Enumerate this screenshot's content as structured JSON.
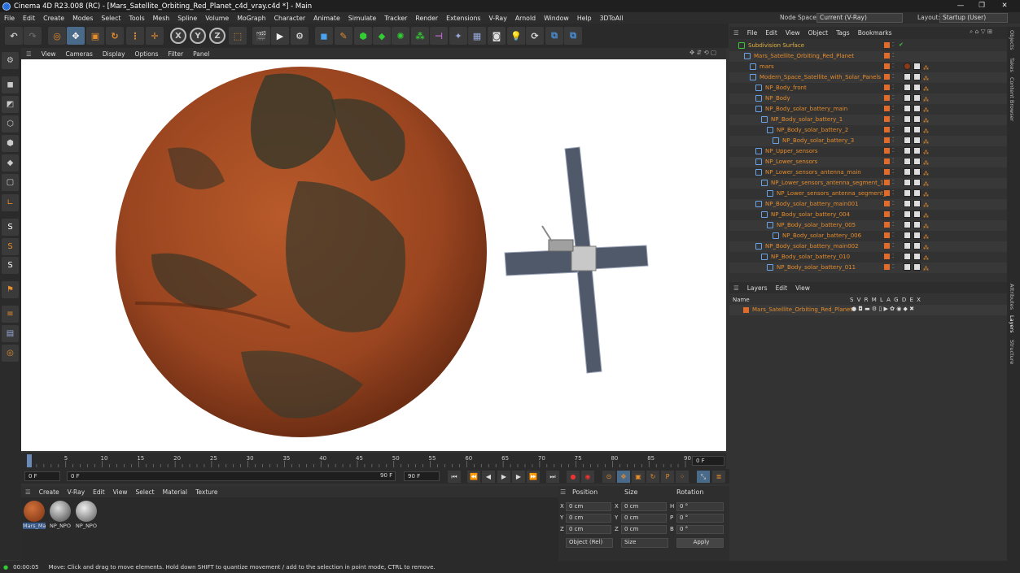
{
  "title": "Cinema 4D R23.008 (RC) - [Mars_Satellite_Orbiting_Red_Planet_c4d_vray.c4d *] - Main",
  "window_controls": [
    "—",
    "❐",
    "✕"
  ],
  "menu": [
    "File",
    "Edit",
    "Create",
    "Modes",
    "Select",
    "Tools",
    "Mesh",
    "Spline",
    "Volume",
    "MoGraph",
    "Character",
    "Animate",
    "Simulate",
    "Tracker",
    "Render",
    "Extensions",
    "V-Ray",
    "Arnold",
    "Window",
    "Help",
    "3DToAll"
  ],
  "node_space": {
    "label": "Node Space:",
    "value": "Current (V-Ray)"
  },
  "layout": {
    "label": "Layout:",
    "value": "Startup (User)"
  },
  "viewport_menu": [
    "View",
    "Cameras",
    "Display",
    "Options",
    "Filter",
    "Panel"
  ],
  "timeline": {
    "ticks": [
      "0",
      "5",
      "10",
      "15",
      "20",
      "25",
      "30",
      "35",
      "40",
      "45",
      "50",
      "55",
      "60",
      "65",
      "70",
      "75",
      "80",
      "85",
      "90"
    ],
    "current_frame_right": "0 F"
  },
  "transport": {
    "start": "0 F",
    "current": "0 F",
    "end_slider": "90 F",
    "end": "90 F"
  },
  "material_menu": [
    "Create",
    "V-Ray",
    "Edit",
    "View",
    "Select",
    "Material",
    "Texture"
  ],
  "materials": [
    {
      "label": "Mars_Ma",
      "color": "#a8451c"
    },
    {
      "label": "NP_NPO",
      "color": "#777777"
    },
    {
      "label": "NP_NPO",
      "color": "#888888"
    }
  ],
  "coords": {
    "headers": [
      "Position",
      "Size",
      "Rotation"
    ],
    "rows": [
      {
        "axis": "X",
        "pos": "0 cm",
        "saxis": "X",
        "size": "0 cm",
        "raxis": "H",
        "rot": "0 °"
      },
      {
        "axis": "Y",
        "pos": "0 cm",
        "saxis": "Y",
        "size": "0 cm",
        "raxis": "P",
        "rot": "0 °"
      },
      {
        "axis": "Z",
        "pos": "0 cm",
        "saxis": "Z",
        "size": "0 cm",
        "raxis": "B",
        "rot": "0 °"
      }
    ],
    "mode": "Object (Rel)",
    "size_mode": "Size",
    "apply": "Apply"
  },
  "status": {
    "time": "00:00:05",
    "message": "Move: Click and drag to move elements. Hold down SHIFT to quantize movement / add to the selection in point mode, CTRL to remove."
  },
  "object_menu": [
    "File",
    "Edit",
    "View",
    "Object",
    "Tags",
    "Bookmarks"
  ],
  "objects": [
    {
      "name": "Subdivision Surface",
      "indent": 0,
      "color": "#e0b040"
    },
    {
      "name": "Mars_Satellite_Orbiting_Red_Planet",
      "indent": 1
    },
    {
      "name": "mars",
      "indent": 2
    },
    {
      "name": "Modern_Space_Satellite_with_Solar_Panels",
      "indent": 2
    },
    {
      "name": "NP_Body_front",
      "indent": 3
    },
    {
      "name": "NP_Body",
      "indent": 3
    },
    {
      "name": "NP_Body_solar_battery_main",
      "indent": 3
    },
    {
      "name": "NP_Body_solar_battery_1",
      "indent": 4
    },
    {
      "name": "NP_Body_solar_battery_2",
      "indent": 5
    },
    {
      "name": "NP_Body_solar_battery_3",
      "indent": 6
    },
    {
      "name": "NP_Upper_sensors",
      "indent": 3
    },
    {
      "name": "NP_Lower_sensors",
      "indent": 3
    },
    {
      "name": "NP_Lower_sensors_antenna_main",
      "indent": 3
    },
    {
      "name": "NP_Lower_sensors_antenna_segment_1",
      "indent": 4
    },
    {
      "name": "NP_Lower_sensors_antenna_segment_2",
      "indent": 5
    },
    {
      "name": "NP_Body_solar_battery_main001",
      "indent": 3
    },
    {
      "name": "NP_Body_solar_battery_004",
      "indent": 4
    },
    {
      "name": "NP_Body_solar_battery_005",
      "indent": 5
    },
    {
      "name": "NP_Body_solar_battery_006",
      "indent": 6
    },
    {
      "name": "NP_Body_solar_battery_main002",
      "indent": 3
    },
    {
      "name": "NP_Body_solar_battery_010",
      "indent": 4
    },
    {
      "name": "NP_Body_solar_battery_011",
      "indent": 5
    }
  ],
  "layer_menu": [
    "Layers",
    "Edit",
    "View"
  ],
  "layer_header": {
    "name": "Name",
    "flags": "S V R M L A G D E X"
  },
  "layer_row": "Mars_Satellite_Orbiting_Red_Planet",
  "right_tabs": [
    "Objects",
    "Takes",
    "Content Browser",
    "Attributes",
    "Layers",
    "Structure"
  ]
}
